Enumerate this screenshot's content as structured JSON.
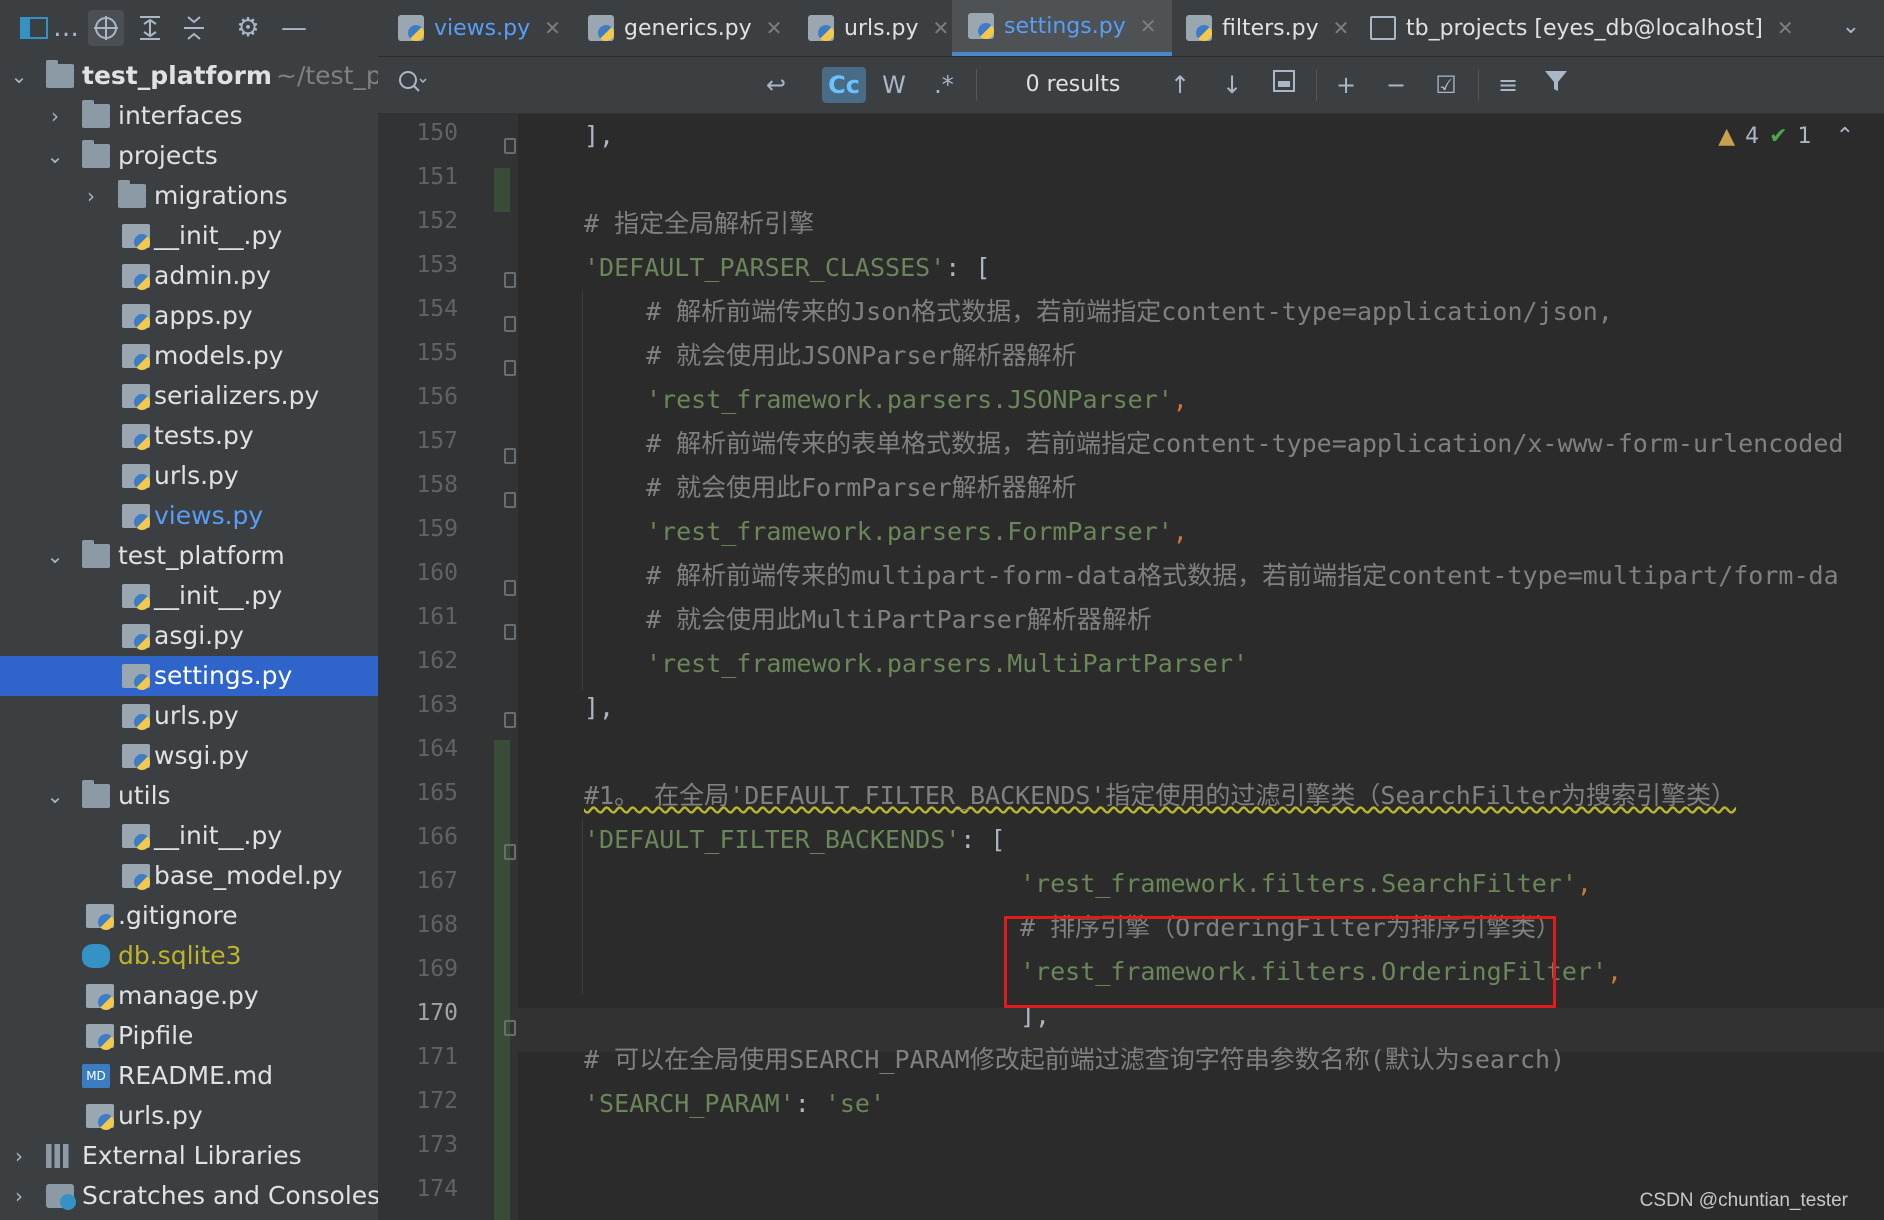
{
  "sidebar": {
    "toolbar": [
      "project-view-icon",
      "locate-icon",
      "expand-all-icon",
      "collapse-all-icon",
      "gear-icon",
      "hide-icon"
    ],
    "project_root": {
      "name": "test_platform",
      "path": "~/test_p"
    },
    "tree": [
      {
        "label": "interfaces"
      },
      {
        "label": "projects"
      },
      {
        "label": "migrations"
      },
      {
        "label": "__init__.py"
      },
      {
        "label": "admin.py"
      },
      {
        "label": "apps.py"
      },
      {
        "label": "models.py"
      },
      {
        "label": "serializers.py"
      },
      {
        "label": "tests.py"
      },
      {
        "label": "urls.py"
      },
      {
        "label": "views.py"
      },
      {
        "label": "test_platform"
      },
      {
        "label": "__init__.py"
      },
      {
        "label": "asgi.py"
      },
      {
        "label": "settings.py"
      },
      {
        "label": "urls.py"
      },
      {
        "label": "wsgi.py"
      },
      {
        "label": "utils"
      },
      {
        "label": "__init__.py"
      },
      {
        "label": "base_model.py"
      },
      {
        "label": ".gitignore"
      },
      {
        "label": "db.sqlite3"
      },
      {
        "label": "manage.py"
      },
      {
        "label": "Pipfile"
      },
      {
        "label": "README.md"
      },
      {
        "label": "urls.py"
      },
      {
        "label": "External Libraries"
      },
      {
        "label": "Scratches and Consoles"
      }
    ],
    "readme_badge": "MD"
  },
  "tabs": [
    {
      "label": "views.py"
    },
    {
      "label": "generics.py"
    },
    {
      "label": "urls.py"
    },
    {
      "label": "settings.py"
    },
    {
      "label": "filters.py"
    },
    {
      "label": "tb_projects [eyes_db@localhost]"
    }
  ],
  "findbar": {
    "match_case": "Cc",
    "words": "W",
    "regex": ".*",
    "results": "0 results"
  },
  "inspection": {
    "warnings": "4",
    "ok": "1"
  },
  "line_numbers": [
    "150",
    "151",
    "152",
    "153",
    "154",
    "155",
    "156",
    "157",
    "158",
    "159",
    "160",
    "161",
    "162",
    "163",
    "164",
    "165",
    "166",
    "167",
    "168",
    "169",
    "170",
    "171",
    "172",
    "173",
    "174"
  ],
  "code": {
    "l150": "],",
    "l152": "# 指定全局解析引擎",
    "l153_key": "'DEFAULT_PARSER_CLASSES'",
    "l153_rest": ": [",
    "l154": "# 解析前端传来的Json格式数据，若前端指定content-type=application/json,",
    "l155": "# 就会使用此JSONParser解析器解析",
    "l156": "'rest_framework.parsers.JSONParser'",
    "l157": "# 解析前端传来的表单格式数据，若前端指定content-type=application/x-www-form-urlencoded",
    "l158": "# 就会使用此FormParser解析器解析",
    "l159": "'rest_framework.parsers.FormParser'",
    "l160": "# 解析前端传来的multipart-form-data格式数据，若前端指定content-type=multipart/form-da",
    "l161": "# 就会使用此MultiPartParser解析器解析",
    "l162": "'rest_framework.parsers.MultiPartParser'",
    "l163": "],",
    "l165": "#1。 在全局'DEFAULT_FILTER_BACKENDS'指定使用的过滤引擎类（SearchFilter为搜索引擎类）",
    "l166_key": "'DEFAULT_FILTER_BACKENDS'",
    "l166_rest": ": [",
    "l167": "'rest_framework.filters.SearchFilter'",
    "l168": "# 排序引擎（OrderingFilter为排序引擎类）",
    "l169": "'rest_framework.filters.OrderingFilter'",
    "l170": "],",
    "l171": "# 可以在全局使用SEARCH_PARAM修改起前端过滤查询字符串参数名称(默认为search)",
    "l172_key": "'SEARCH_PARAM'",
    "l172_val": "'se'",
    "comma": ",",
    "colon": ": "
  },
  "colors": {
    "comment": "#808080",
    "string": "#6a8759",
    "punct": "#cc7832",
    "selection": "#2f65ca",
    "highlight_box": "#e01b1b"
  },
  "watermark": "CSDN @chuntian_tester"
}
